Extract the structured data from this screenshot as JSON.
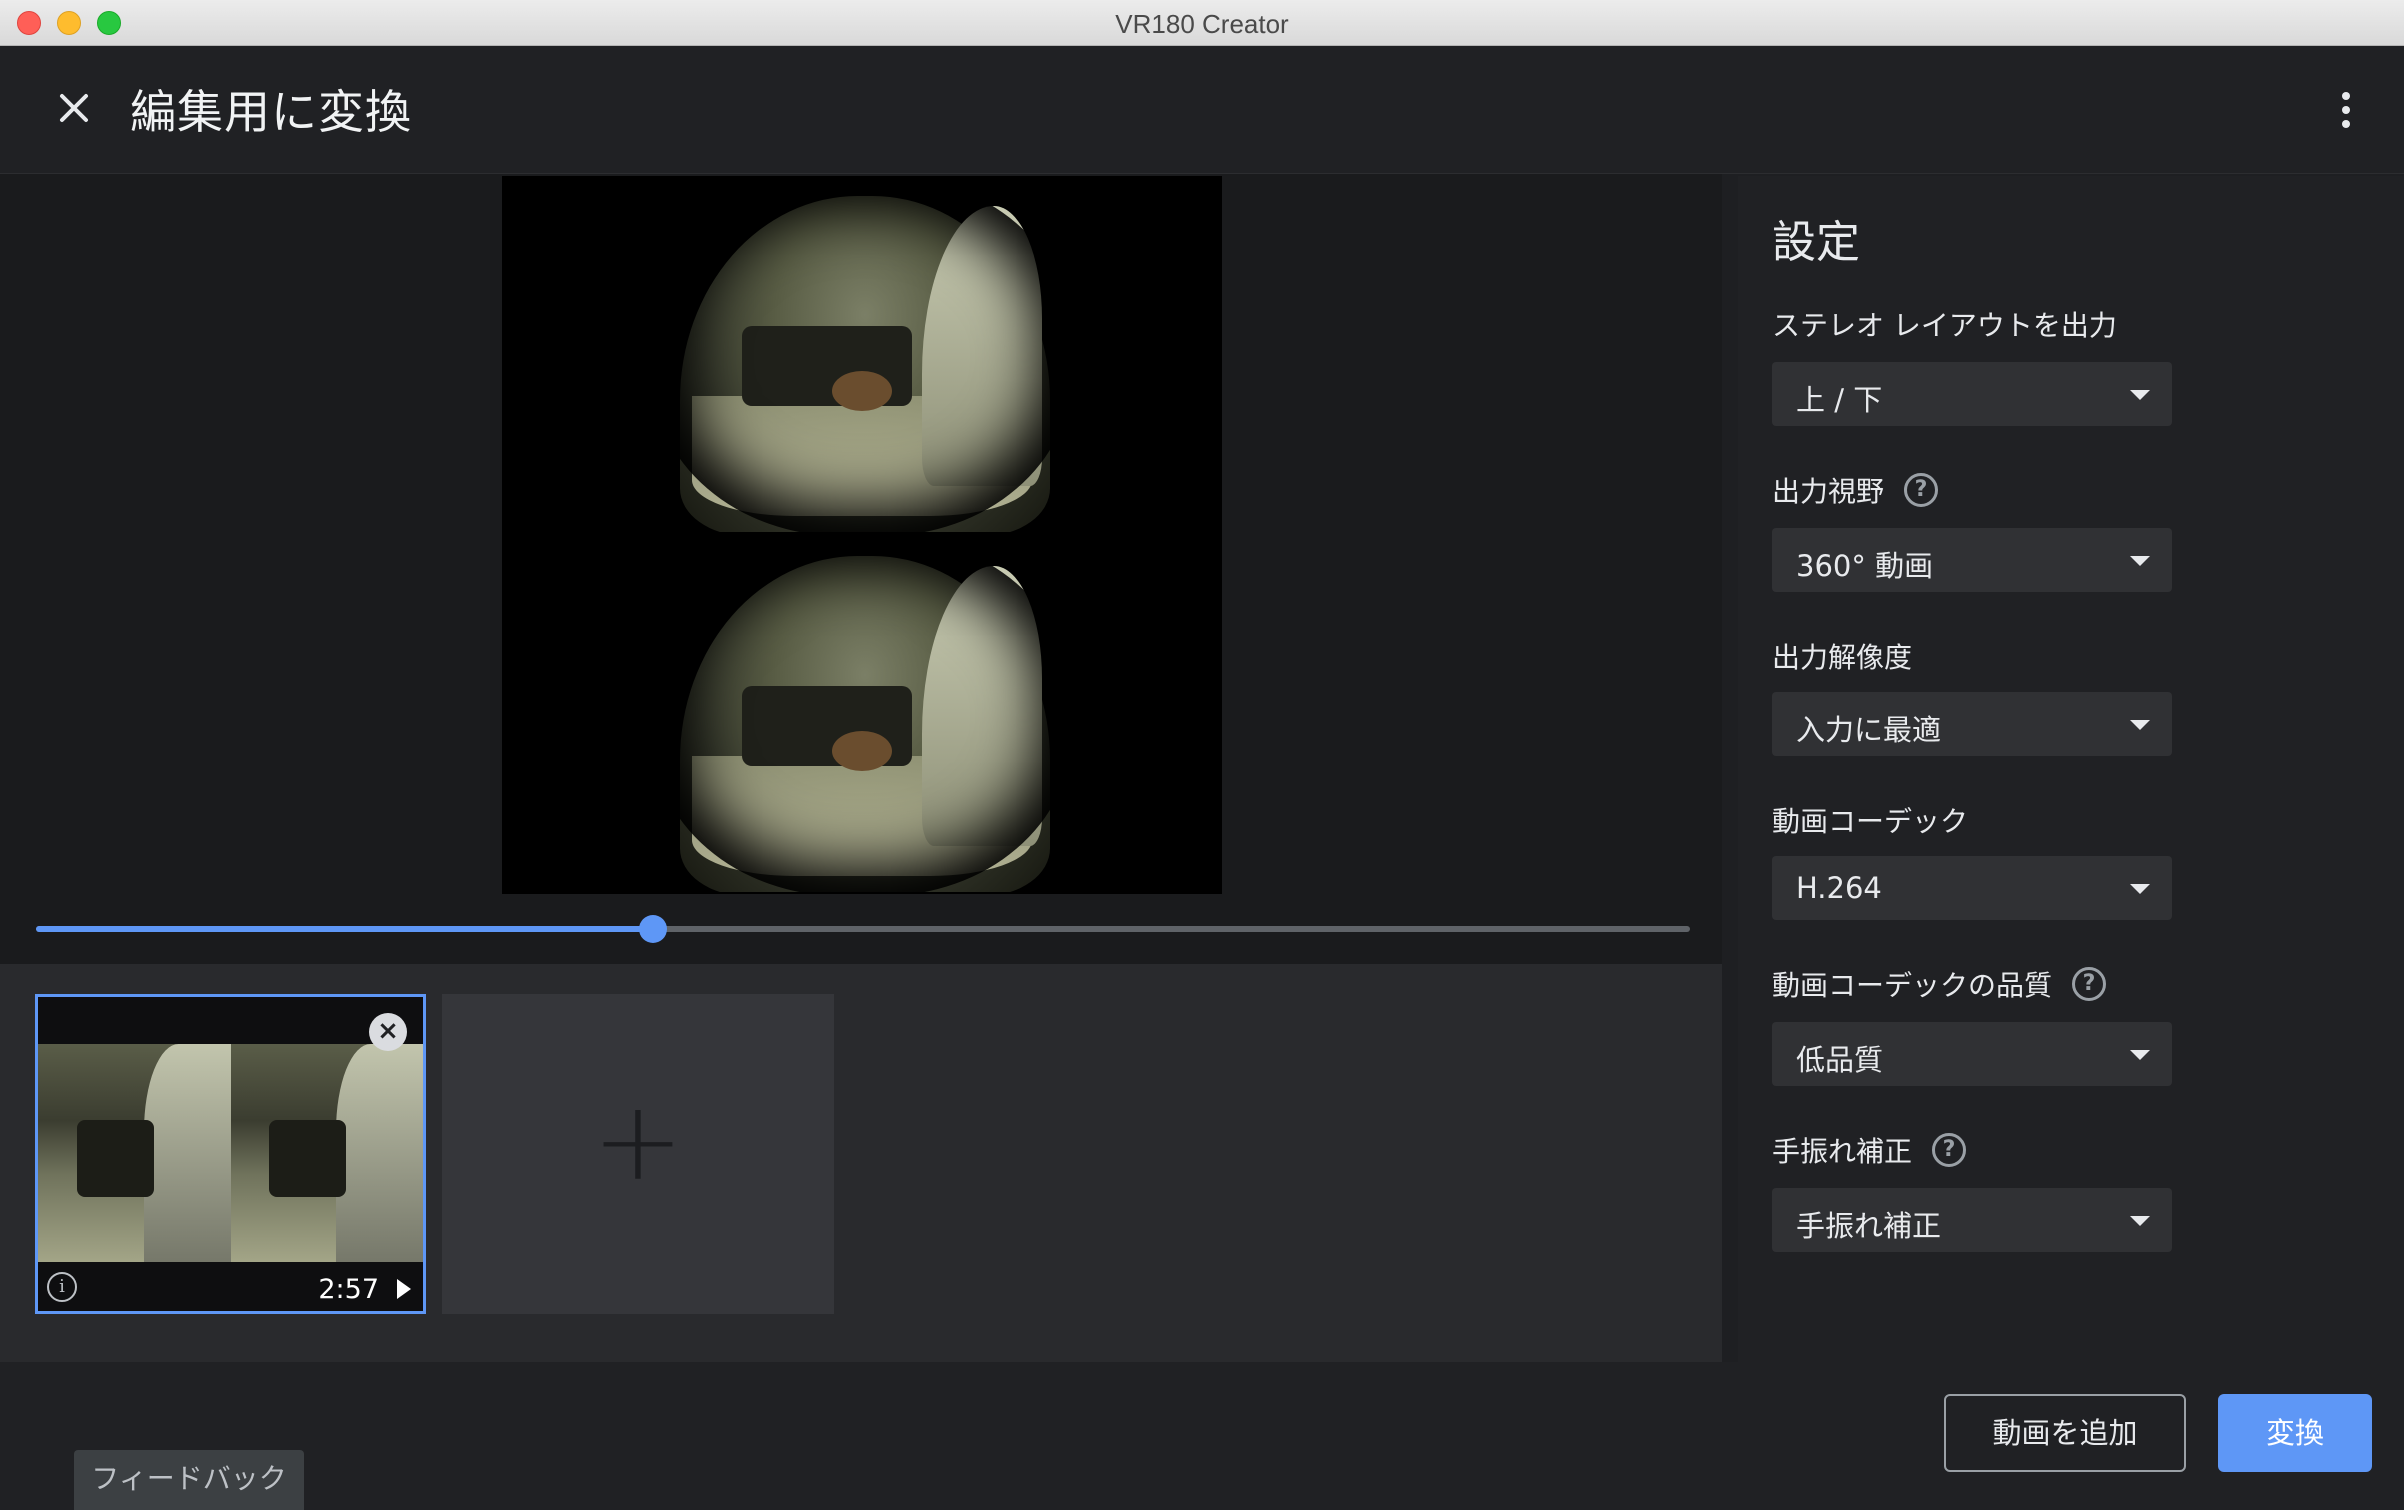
{
  "window": {
    "title": "VR180 Creator"
  },
  "header": {
    "title": "編集用に変換"
  },
  "player": {
    "progress_fraction": 0.373
  },
  "clips": [
    {
      "duration": "2:57",
      "selected": true
    }
  ],
  "settings": {
    "title": "設定",
    "fields": [
      {
        "label": "ステレオ レイアウトを出力",
        "value": "上 / 下",
        "help": false
      },
      {
        "label": "出力視野",
        "value": "360° 動画",
        "help": true
      },
      {
        "label": "出力解像度",
        "value": "入力に最適",
        "help": false
      },
      {
        "label": "動画コーデック",
        "value": "H.264",
        "help": false
      },
      {
        "label": "動画コーデックの品質",
        "value": "低品質",
        "help": true
      },
      {
        "label": "手振れ補正",
        "value": "手振れ補正",
        "help": true
      }
    ]
  },
  "footer": {
    "add_video_label": "動画を追加",
    "convert_label": "変換",
    "feedback_label": "フィードバック"
  },
  "colors": {
    "accent": "#5e97f6",
    "background": "#202124",
    "panel": "#303134"
  }
}
